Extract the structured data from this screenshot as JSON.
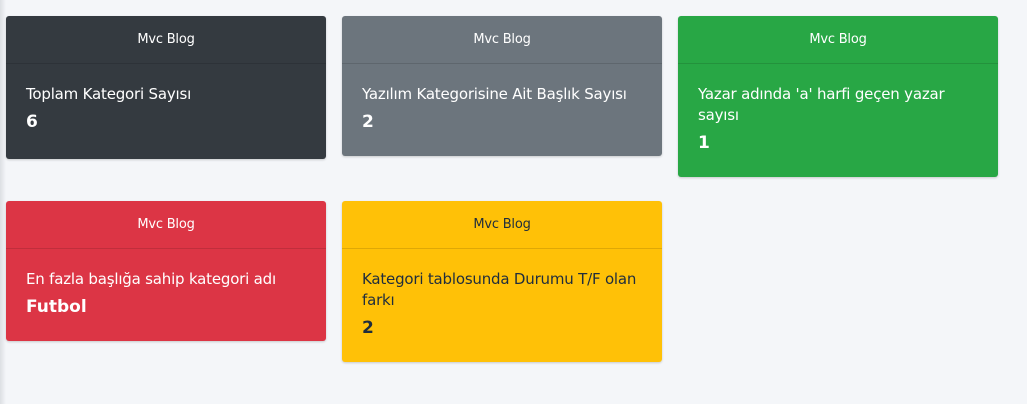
{
  "colors": {
    "page_background": "#f4f6f9",
    "dark": "#343a40",
    "secondary": "#6c757d",
    "success": "#28a745",
    "danger": "#dc3545",
    "warning": "#ffc107"
  },
  "cards": [
    {
      "header": "Mvc Blog",
      "title": "Toplam Kategori Sayısı",
      "value": "6",
      "color": "dark"
    },
    {
      "header": "Mvc Blog",
      "title": "Yazılım Kategorisine Ait Başlık Sayısı",
      "value": "2",
      "color": "secondary"
    },
    {
      "header": "Mvc Blog",
      "title": "Yazar adında 'a' harfi geçen yazar sayısı",
      "value": "1",
      "color": "success"
    },
    {
      "header": "Mvc Blog",
      "title": "En fazla başlığa sahip kategori adı",
      "value": "Futbol",
      "color": "danger"
    },
    {
      "header": "Mvc Blog",
      "title": "Kategori tablosunda Durumu T/F olan farkı",
      "value": "2",
      "color": "warning"
    }
  ]
}
